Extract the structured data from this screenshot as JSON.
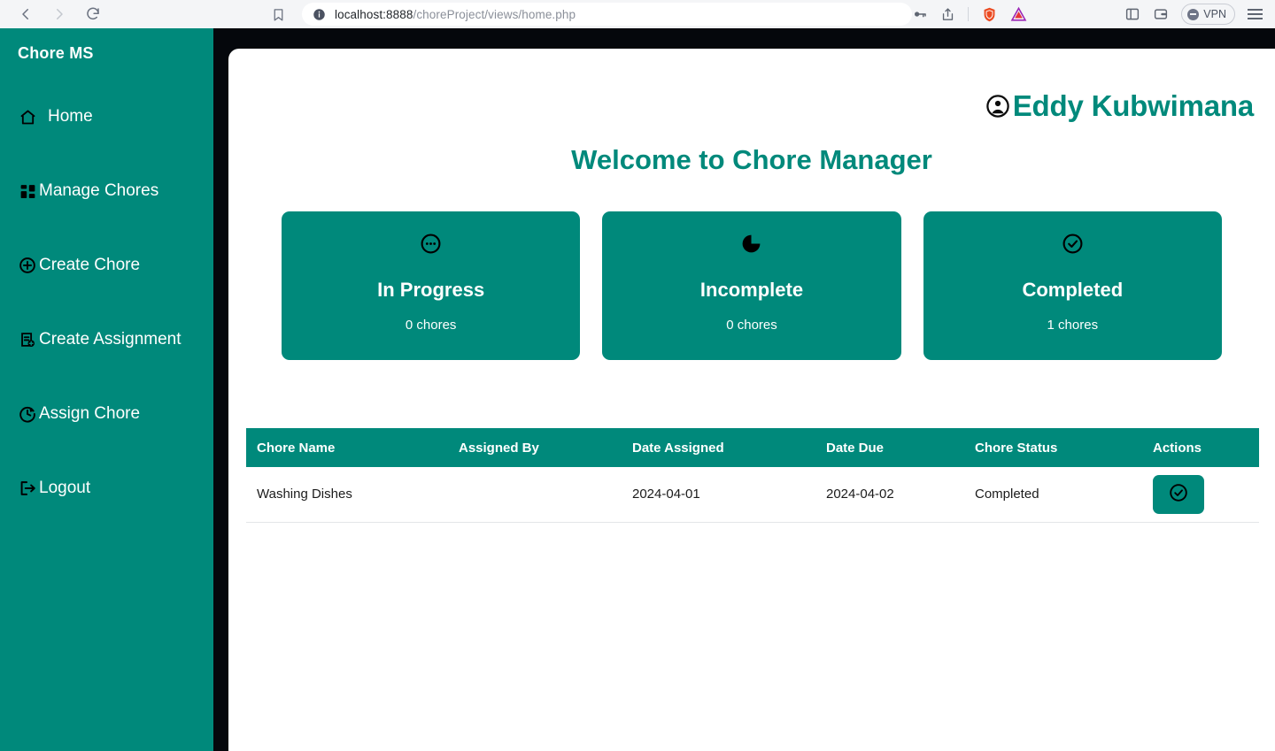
{
  "browser": {
    "back_label": "back",
    "forward_label": "forward",
    "reload_label": "reload",
    "bookmark_label": "bookmark",
    "url_host": "localhost:8888",
    "url_path": "/choreProject/views/home.php",
    "url_full": "localhost:8888/choreProject/views/home.php",
    "actions": {
      "password_label": "passwords",
      "share_label": "share",
      "brave_shields_label": "Brave Shields",
      "bat_rewards_label": "Brave Rewards",
      "sidebar_label": "sidebar",
      "wallet_label": "wallet",
      "vpn_label": "VPN",
      "menu_label": "menu"
    }
  },
  "sidebar": {
    "brand": "Chore MS",
    "items": [
      {
        "label": "Home",
        "icon": "home-icon",
        "name": "home"
      },
      {
        "label": "Manage Chores",
        "icon": "grid-icon",
        "name": "manage-chores"
      },
      {
        "label": "Create Chore",
        "icon": "plus-circle-icon",
        "name": "create-chore"
      },
      {
        "label": "Create Assignment",
        "icon": "clipboard-plus-icon",
        "name": "create-assignment"
      },
      {
        "label": "Assign Chore",
        "icon": "clock-arrow-icon",
        "name": "assign-chore"
      },
      {
        "label": "Logout",
        "icon": "logout-icon",
        "name": "logout"
      }
    ]
  },
  "header": {
    "user_name": "Eddy Kubwimana",
    "avatar_icon": "user-circle-icon"
  },
  "main": {
    "welcome_title": "Welcome to Chore Manager",
    "stat_cards": [
      {
        "label": "In Progress",
        "count": "0 chores",
        "icon": "dots-circle-icon"
      },
      {
        "label": "Incomplete",
        "count": "0 chores",
        "icon": "pie-chart-icon"
      },
      {
        "label": "Completed",
        "count": "1 chores",
        "icon": "check-circle-icon"
      }
    ],
    "table": {
      "columns": [
        "Chore Name",
        "Assigned By",
        "Date Assigned",
        "Date Due",
        "Chore Status",
        "Actions"
      ],
      "rows": [
        {
          "chore_name": "Washing Dishes",
          "assigned_by": "",
          "date_assigned": "2024-04-01",
          "date_due": "2024-04-02",
          "chore_status": "Completed",
          "action_icon": "check-circle-icon"
        }
      ]
    }
  },
  "colors": {
    "teal": "#00897b",
    "white": "#ffffff",
    "page_dark": "#05070c",
    "text_dark": "#1b1b1b"
  }
}
